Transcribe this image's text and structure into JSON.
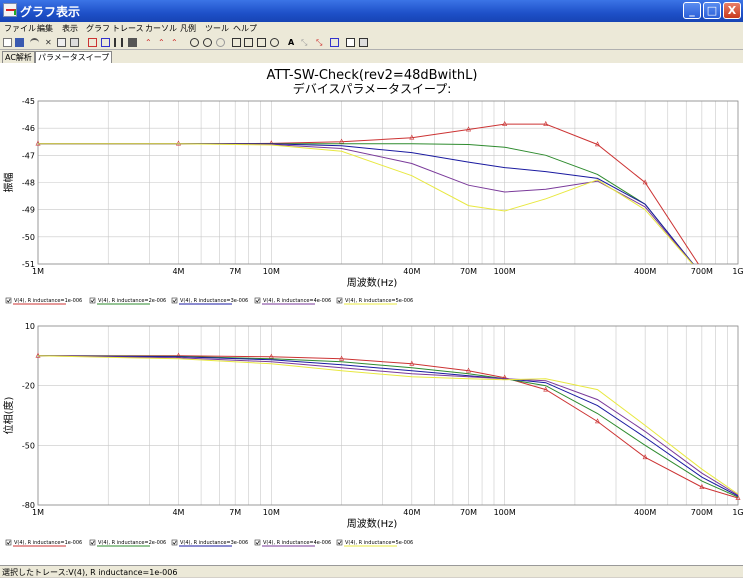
{
  "window": {
    "title": "グラフ表示",
    "min_label": "_",
    "max_label": "□",
    "close_label": "X"
  },
  "menu": [
    "ファイル",
    "編集",
    "表示",
    "グラフ",
    "トレース",
    "カーソル",
    "凡例",
    "ツール",
    "ヘルプ"
  ],
  "tabs": [
    "AC解析",
    "パラメータスイープ"
  ],
  "status": "選択したトレース:V(4), R  inductance=1e-006",
  "chart_title_1": "ATT-SW-Check(rev2=48dBwithL)",
  "chart_title_2": "デバイスパラメータスイープ:",
  "colors": {
    "series": [
      "#cc3333",
      "#2e8b2e",
      "#1a1aa0",
      "#7a3a9a",
      "#e8e840"
    ],
    "grid": "#c8c8c8"
  },
  "chart_data": [
    {
      "type": "line",
      "ylabel": "振幅",
      "xlabel": "周波数(Hz)",
      "xscale": "log",
      "xlim": [
        1000000,
        1000000000
      ],
      "ylim": [
        -51,
        -45
      ],
      "x_ticks": [
        "1M",
        "4M",
        "7M",
        "10M",
        "40M",
        "70M",
        "100M",
        "400M",
        "700M",
        "1G"
      ],
      "y_ticks": [
        "-45",
        "-46",
        "-47",
        "-48",
        "-49",
        "-50",
        "-51"
      ],
      "x": [
        1000000,
        4000000,
        10000000,
        20000000,
        40000000,
        70000000,
        100000000,
        150000000,
        250000000,
        400000000,
        700000000
      ],
      "series": [
        {
          "name": "V(4), R  inductance=1e-006",
          "values": [
            -46.57,
            -46.57,
            -46.56,
            -46.5,
            -46.35,
            -46.05,
            -45.85,
            -45.85,
            -46.6,
            -48.0,
            -51.2
          ]
        },
        {
          "name": "V(4), R  inductance=2e-006",
          "values": [
            -46.57,
            -46.57,
            -46.57,
            -46.57,
            -46.57,
            -46.6,
            -46.7,
            -47.0,
            -47.7,
            -48.8,
            -51.4
          ]
        },
        {
          "name": "V(4), R  inductance=3e-006",
          "values": [
            -46.57,
            -46.57,
            -46.58,
            -46.65,
            -46.9,
            -47.25,
            -47.45,
            -47.6,
            -47.85,
            -48.8,
            -51.4
          ]
        },
        {
          "name": "V(4), R  inductance=4e-006",
          "values": [
            -46.57,
            -46.57,
            -46.6,
            -46.75,
            -47.3,
            -48.1,
            -48.35,
            -48.25,
            -47.95,
            -48.9,
            -51.4
          ]
        },
        {
          "name": "V(4), R  inductance=5e-006",
          "values": [
            -46.57,
            -46.57,
            -46.62,
            -46.85,
            -47.75,
            -48.85,
            -49.05,
            -48.6,
            -47.9,
            -49.0,
            -51.4
          ]
        }
      ]
    },
    {
      "type": "line",
      "ylabel": "位相(度)",
      "xlabel": "周波数(Hz)",
      "xscale": "log",
      "xlim": [
        1000000,
        1000000000
      ],
      "ylim": [
        -80,
        10
      ],
      "x_ticks": [
        "1M",
        "4M",
        "7M",
        "10M",
        "40M",
        "70M",
        "100M",
        "400M",
        "700M",
        "1G"
      ],
      "y_ticks": [
        "10",
        "-20",
        "-50",
        "-80"
      ],
      "x": [
        1000000,
        4000000,
        10000000,
        20000000,
        40000000,
        70000000,
        100000000,
        150000000,
        250000000,
        400000000,
        700000000,
        1000000000
      ],
      "series": [
        {
          "name": "V(4), R  inductance=1e-006",
          "values": [
            -5.0,
            -5.0,
            -5.5,
            -6.5,
            -9.0,
            -12.5,
            -16.0,
            -22.0,
            -38.0,
            -56.0,
            -71.0,
            -76.5
          ]
        },
        {
          "name": "V(4), R  inductance=2e-006",
          "values": [
            -5.0,
            -5.3,
            -6.5,
            -8.0,
            -11.0,
            -14.0,
            -16.5,
            -20.0,
            -34.0,
            -50.0,
            -68.0,
            -76.0
          ]
        },
        {
          "name": "V(4), R  inductance=3e-006",
          "values": [
            -5.0,
            -5.5,
            -7.0,
            -9.5,
            -12.5,
            -15.0,
            -16.5,
            -18.5,
            -30.0,
            -46.0,
            -66.0,
            -75.5
          ]
        },
        {
          "name": "V(4), R  inductance=4e-006",
          "values": [
            -5.0,
            -6.0,
            -8.0,
            -11.0,
            -14.0,
            -15.5,
            -16.5,
            -17.5,
            -27.0,
            -43.0,
            -64.0,
            -75.0
          ]
        },
        {
          "name": "V(4), R  inductance=5e-006",
          "values": [
            -5.0,
            -6.5,
            -9.0,
            -12.5,
            -15.5,
            -16.5,
            -17.0,
            -16.5,
            -22.0,
            -40.0,
            -62.0,
            -74.5
          ]
        }
      ]
    }
  ]
}
